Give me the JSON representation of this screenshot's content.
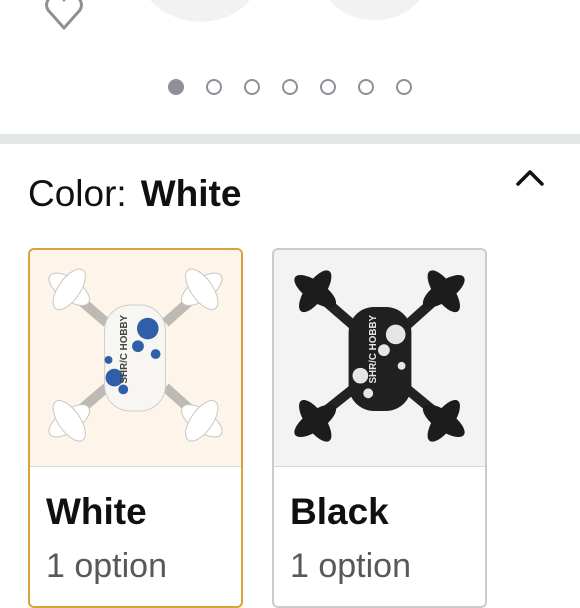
{
  "gallery": {
    "favorite_icon": "heart-outline-icon",
    "dot_count": 7,
    "active_index": 0
  },
  "color_selector": {
    "label": "Color:",
    "selected_value": "White",
    "collapse_icon": "chevron-up-icon"
  },
  "variants": [
    {
      "name": "White",
      "options": "1 option",
      "brand_print": "SHR/C HOBBY",
      "selected": true
    },
    {
      "name": "Black",
      "options": "1 option",
      "brand_print": "SHR/C HOBBY",
      "selected": false
    }
  ],
  "colors": {
    "selected_border": "#d9a33c",
    "dot": "#8d9096",
    "divider": "#e3e6e6"
  }
}
